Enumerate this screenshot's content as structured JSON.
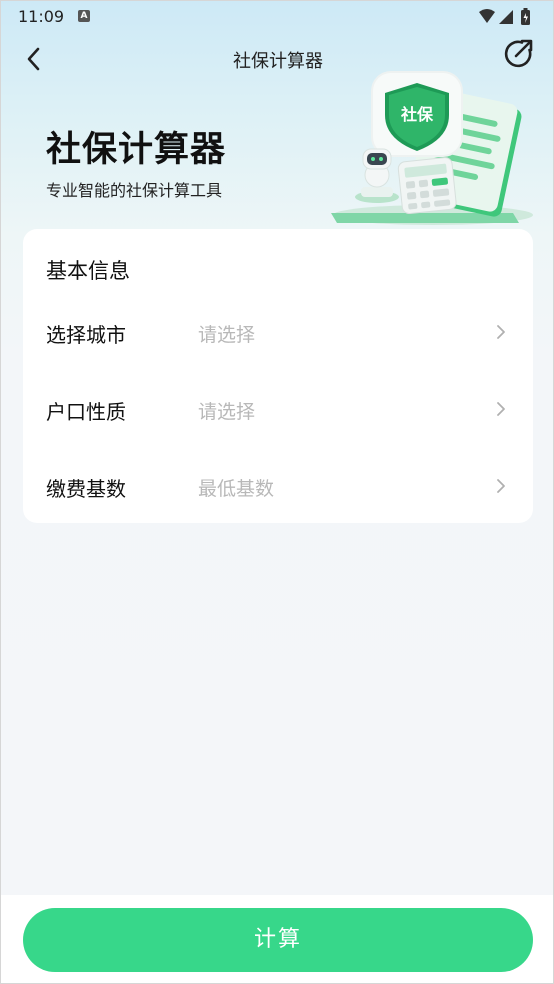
{
  "status_bar": {
    "time": "11:09",
    "notification_badge": "A"
  },
  "nav": {
    "title": "社保计算器"
  },
  "hero": {
    "title": "社保计算器",
    "subtitle": "专业智能的社保计算工具",
    "badge_text": "社保"
  },
  "card": {
    "title": "基本信息",
    "rows": [
      {
        "label": "选择城市",
        "placeholder": "请选择"
      },
      {
        "label": "户口性质",
        "placeholder": "请选择"
      },
      {
        "label": "缴费基数",
        "placeholder": "最低基数"
      }
    ]
  },
  "footer": {
    "calculate_label": "计算"
  },
  "colors": {
    "accent": "#37d78a",
    "placeholder": "#b8b8b8"
  }
}
